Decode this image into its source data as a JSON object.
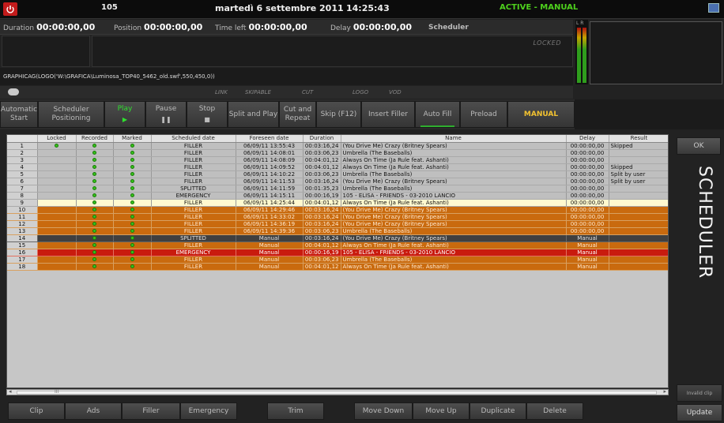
{
  "topbar": {
    "channel": "105",
    "date": "martedì 6 settembre 2011",
    "time": "14:25:43",
    "mode": "ACTIVE - MANUAL"
  },
  "infobar": {
    "duration_label": "Duration",
    "duration_value": "00:00:00,00",
    "position_label": "Position",
    "position_value": "00:00:00,00",
    "timeleft_label": "Time left",
    "timeleft_value": "00:00:00,00",
    "delay_label": "Delay",
    "delay_value": "00:00:00,00",
    "scheduler_label": "Scheduler"
  },
  "panel": {
    "locked": "LOCKED",
    "command": "GRAPHICAG(LOGO('W:\\GRAFICA\\Luminosa_TOP40_5462_old.swf',550,450,0))"
  },
  "vu": {
    "label": "L R"
  },
  "flags": {
    "link": "LINK",
    "skipable": "SKIPABLE",
    "cut": "CUT",
    "logo": "LOGO",
    "vod": "VOD"
  },
  "toolbar": {
    "automatic_start": "Automatic Start",
    "scheduler_positioning": "Scheduler Positioning",
    "play": "Play",
    "pause": "Pause",
    "stop": "Stop",
    "split_and_play": "Split and Play",
    "cut_and_repeat": "Cut and Repeat",
    "skip": "Skip (F12)",
    "insert_filler": "Insert Filler",
    "auto_fill": "Auto Fill",
    "preload": "Preload",
    "manual": "MANUAL"
  },
  "table": {
    "columns": [
      "",
      "Locked",
      "Recorded",
      "Marked",
      "Scheduled date",
      "Foreseen date",
      "Duration",
      "Name",
      "Delay",
      "Result"
    ],
    "rows": [
      {
        "idx": "1",
        "locked": true,
        "recorded": true,
        "marked": true,
        "sched": "FILLER",
        "foreseen": "06/09/11 13:55:43",
        "duration": "00:03:16,24",
        "name": "(You Drive Me) Crazy  (Britney Spears)",
        "delay": "00:00:00,00",
        "result": "Skipped",
        "style": "grey"
      },
      {
        "idx": "2",
        "locked": false,
        "recorded": true,
        "marked": true,
        "sched": "FILLER",
        "foreseen": "06/09/11 14:08:01",
        "duration": "00:03:06,23",
        "name": "Umbrella  (The Baseballs)",
        "delay": "00:00:00,00",
        "result": "",
        "style": "grey"
      },
      {
        "idx": "3",
        "locked": false,
        "recorded": true,
        "marked": true,
        "sched": "FILLER",
        "foreseen": "06/09/11 14:08:09",
        "duration": "00:04:01,12",
        "name": "Always On Time  (Ja Rule feat. Ashanti)",
        "delay": "00:00:00,00",
        "result": "",
        "style": "grey"
      },
      {
        "idx": "4",
        "locked": false,
        "recorded": true,
        "marked": true,
        "sched": "FILLER",
        "foreseen": "06/09/11 14:09:52",
        "duration": "00:04:01,12",
        "name": "Always On Time  (Ja Rule feat. Ashanti)",
        "delay": "00:00:00,00",
        "result": "Skipped",
        "style": "grey"
      },
      {
        "idx": "5",
        "locked": false,
        "recorded": true,
        "marked": true,
        "sched": "FILLER",
        "foreseen": "06/09/11 14:10:22",
        "duration": "00:03:06,23",
        "name": "Umbrella  (The Baseballs)",
        "delay": "00:00:00,00",
        "result": "Split by user",
        "style": "grey"
      },
      {
        "idx": "6",
        "locked": false,
        "recorded": true,
        "marked": true,
        "sched": "FILLER",
        "foreseen": "06/09/11 14:11:53",
        "duration": "00:03:16,24",
        "name": "(You Drive Me) Crazy  (Britney Spears)",
        "delay": "00:00:00,00",
        "result": "Split by user",
        "style": "grey"
      },
      {
        "idx": "7",
        "locked": false,
        "recorded": true,
        "marked": true,
        "sched": "SPLITTED",
        "foreseen": "06/09/11 14:11:59",
        "duration": "00:01:35,23",
        "name": "Umbrella  (The Baseballs)",
        "delay": "00:00:00,00",
        "result": "",
        "style": "grey"
      },
      {
        "idx": "8",
        "locked": false,
        "recorded": true,
        "marked": true,
        "sched": "EMERGENCY",
        "foreseen": "06/09/11 14:15:11",
        "duration": "00:00:16,19",
        "name": "105 - ELISA - FRIENDS - 03-2010 LANCIO",
        "delay": "00:00:00,00",
        "result": "",
        "style": "grey"
      },
      {
        "idx": "9",
        "locked": false,
        "recorded": true,
        "marked": true,
        "sched": "FILLER",
        "foreseen": "06/09/11 14:25:44",
        "duration": "00:04:01,12",
        "name": "Always On Time  (Ja Rule feat. Ashanti)",
        "delay": "00:00:00,00",
        "result": "",
        "style": "yellow"
      },
      {
        "idx": "10",
        "locked": false,
        "recorded": true,
        "marked": true,
        "sched": "FILLER",
        "foreseen": "06/09/11 14:29:46",
        "duration": "00:03:16,24",
        "name": "(You Drive Me) Crazy  (Britney Spears)",
        "delay": "00:00:00,00",
        "result": "",
        "style": "orange"
      },
      {
        "idx": "11",
        "locked": false,
        "recorded": true,
        "marked": true,
        "sched": "FILLER",
        "foreseen": "06/09/11 14:33:02",
        "duration": "00:03:16,24",
        "name": "(You Drive Me) Crazy  (Britney Spears)",
        "delay": "00:00:00,00",
        "result": "",
        "style": "orange"
      },
      {
        "idx": "12",
        "locked": false,
        "recorded": true,
        "marked": true,
        "sched": "FILLER",
        "foreseen": "06/09/11 14:36:19",
        "duration": "00:03:16,24",
        "name": "(You Drive Me) Crazy  (Britney Spears)",
        "delay": "00:00:00,00",
        "result": "",
        "style": "orange"
      },
      {
        "idx": "13",
        "locked": false,
        "recorded": true,
        "marked": true,
        "sched": "FILLER",
        "foreseen": "06/09/11 14:39:36",
        "duration": "00:03:06,23",
        "name": "Umbrella  (The Baseballs)",
        "delay": "00:00:00,00",
        "result": "",
        "style": "orange"
      },
      {
        "idx": "14",
        "locked": false,
        "recorded": true,
        "marked": true,
        "sched": "SPLITTED",
        "foreseen": "Manual",
        "duration": "00:03:16,24",
        "name": "(You Drive Me) Crazy  (Britney Spears)",
        "delay": "Manual",
        "result": "",
        "style": "dark"
      },
      {
        "idx": "15",
        "locked": false,
        "recorded": true,
        "marked": true,
        "sched": "FILLER",
        "foreseen": "Manual",
        "duration": "00:04:01,12",
        "name": "Always On Time  (Ja Rule feat. Ashanti)",
        "delay": "Manual",
        "result": "",
        "style": "orange"
      },
      {
        "idx": "16",
        "locked": false,
        "recorded": true,
        "marked": true,
        "sched": "EMERGENCY",
        "foreseen": "Manual",
        "duration": "00:00:16,19",
        "name": "105 - ELISA - FRIENDS - 03-2010 LANCIO",
        "delay": "Manual",
        "result": "",
        "style": "red"
      },
      {
        "idx": "17",
        "locked": false,
        "recorded": true,
        "marked": true,
        "sched": "FILLER",
        "foreseen": "Manual",
        "duration": "00:03:06,23",
        "name": "Umbrella  (The Baseballs)",
        "delay": "Manual",
        "result": "",
        "style": "orange"
      },
      {
        "idx": "18",
        "locked": false,
        "recorded": true,
        "marked": true,
        "sched": "FILLER",
        "foreseen": "Manual",
        "duration": "00:04:01,12",
        "name": "Always On Time  (Ja Rule feat. Ashanti)",
        "delay": "Manual",
        "result": "",
        "style": "orange"
      }
    ]
  },
  "side": {
    "ok": "OK",
    "scheduler": "SCHEDULER",
    "invalid_clip": "Invalid clip",
    "update": "Update"
  },
  "bottom": {
    "clip": "Clip",
    "ads": "Ads",
    "filler": "Filler",
    "emergency": "Emergency",
    "trim": "Trim",
    "move_down": "Move Down",
    "move_up": "Move Up",
    "duplicate": "Duplicate",
    "delete": "Delete"
  },
  "scrollbar": {
    "grip": "III"
  },
  "colors": {
    "active_green": "#4ed11d",
    "manual_yellow": "#f2c230",
    "row_orange": "#c96a0e",
    "row_red": "#c91b0e",
    "row_yellow": "#fff9cf"
  }
}
